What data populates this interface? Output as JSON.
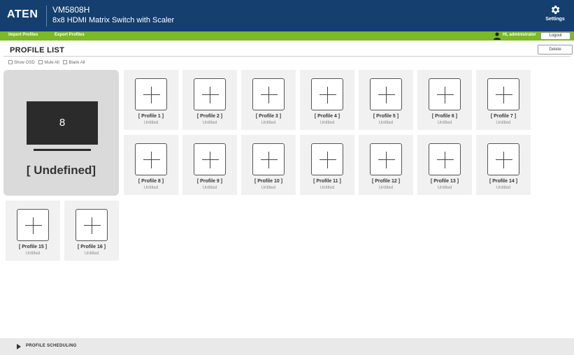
{
  "header": {
    "logo": "ATEN",
    "model": "VM5808H",
    "product": "8x8 HDMI Matrix Switch with Scaler",
    "settings_label": "Settings"
  },
  "toolbar": {
    "import_label": "Import Profiles",
    "export_label": "Export Profiles",
    "user_label": "Hi, administrator",
    "logout_label": "Logout"
  },
  "page": {
    "title": "PROFILE LIST",
    "delete_label": "Delete"
  },
  "options": [
    {
      "label": "Show OSD",
      "checked": false
    },
    {
      "label": "Mute All",
      "checked": false
    },
    {
      "label": "Blank All",
      "checked": false
    }
  ],
  "current_profile": {
    "number": "8",
    "label": "[ Undefined]"
  },
  "profiles": [
    {
      "name": "[ Profile 1 ]",
      "status": "Untitled"
    },
    {
      "name": "[ Profile 2 ]",
      "status": "Untitled"
    },
    {
      "name": "[ Profile 3 ]",
      "status": "Untitled"
    },
    {
      "name": "[ Profile 4 ]",
      "status": "Untitled"
    },
    {
      "name": "[ Profile 5 ]",
      "status": "Untitled"
    },
    {
      "name": "[ Profile 6 ]",
      "status": "Untitled"
    },
    {
      "name": "[ Profile 7 ]",
      "status": "Untitled"
    },
    {
      "name": "[ Profile 8 ]",
      "status": "Untitled"
    },
    {
      "name": "[ Profile 9 ]",
      "status": "Untitled"
    },
    {
      "name": "[ Profile 10 ]",
      "status": "Untitled"
    },
    {
      "name": "[ Profile 11 ]",
      "status": "Untitled"
    },
    {
      "name": "[ Profile 12 ]",
      "status": "Untitled"
    },
    {
      "name": "[ Profile 13 ]",
      "status": "Untitled"
    },
    {
      "name": "[ Profile 14 ]",
      "status": "Untitled"
    },
    {
      "name": "[ Profile 15 ]",
      "status": "Untitled"
    },
    {
      "name": "[ Profile 16 ]",
      "status": "Untitled"
    }
  ],
  "footer": {
    "scheduling_label": "PROFILE SCHEDULING"
  },
  "colors": {
    "header_bg": "#143f6f",
    "toolbar_bg": "#7bb927"
  }
}
